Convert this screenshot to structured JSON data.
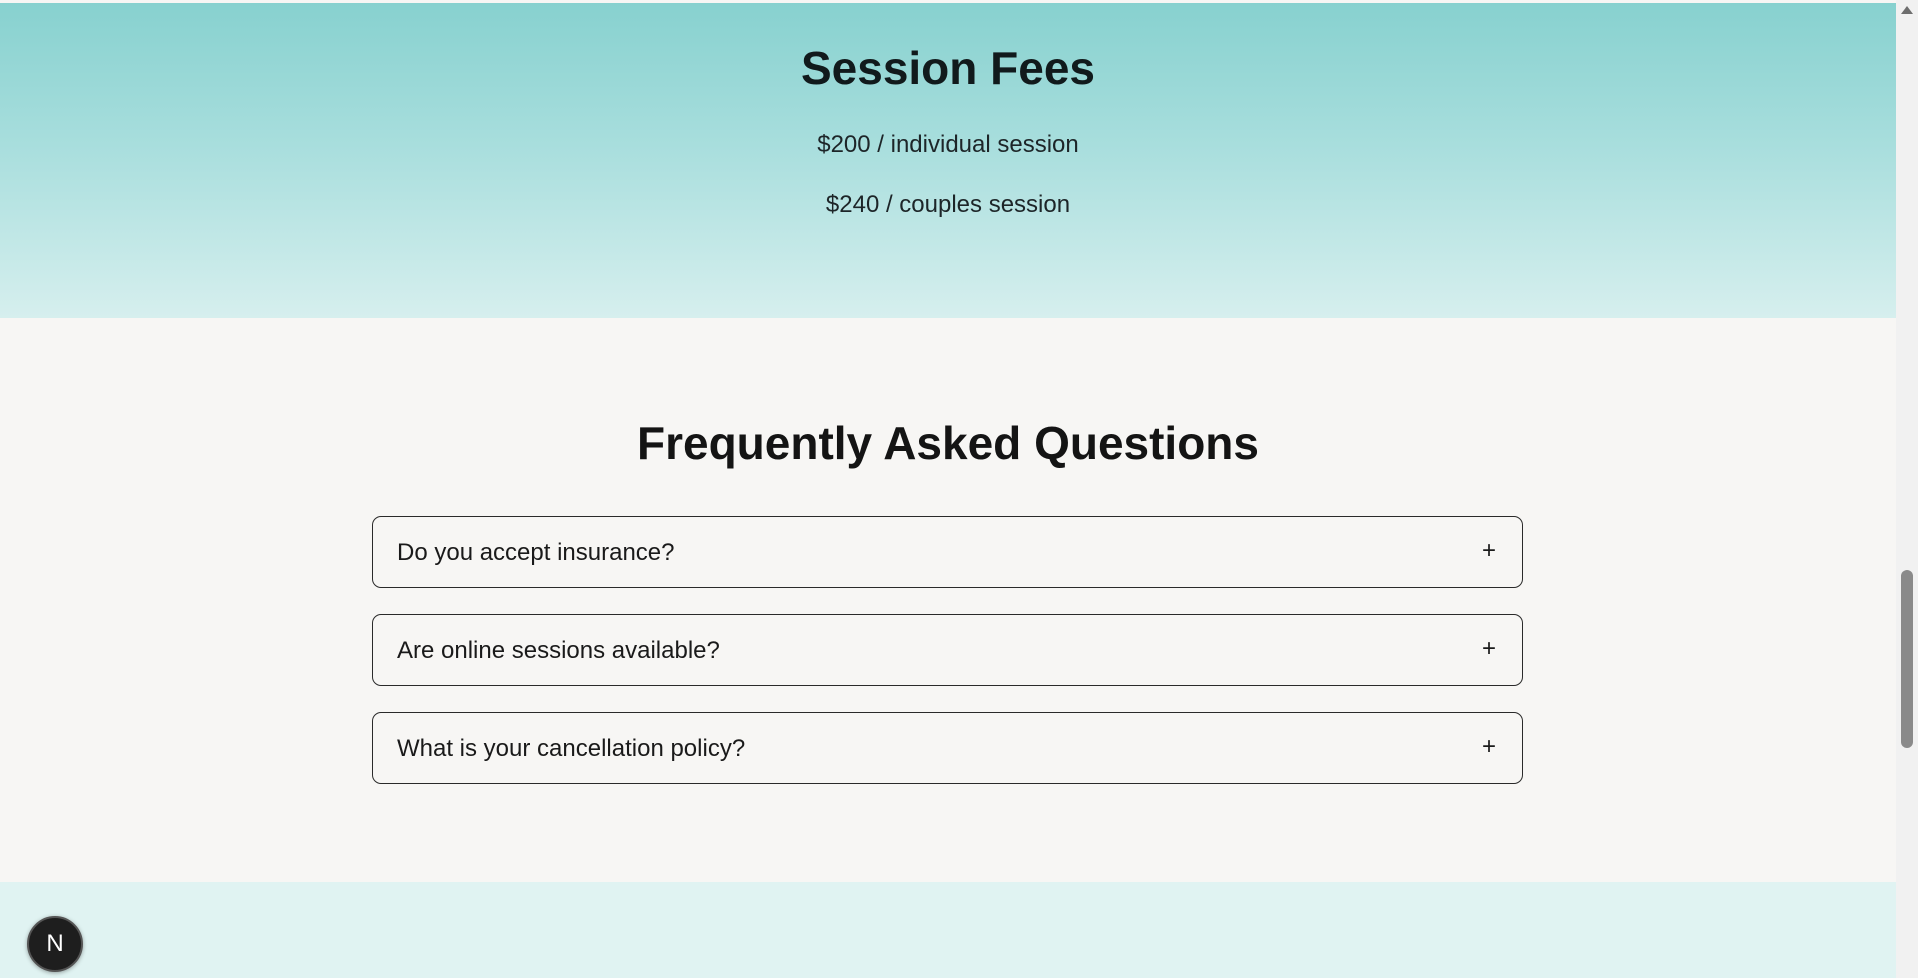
{
  "fees": {
    "title": "Session Fees",
    "individual": "$200 / individual session",
    "couples": "$240 / couples session"
  },
  "faq": {
    "title": "Frequently Asked Questions",
    "items": [
      {
        "question": "Do you accept insurance?",
        "toggle": "+"
      },
      {
        "question": "Are online sessions available?",
        "toggle": "+"
      },
      {
        "question": "What is your cancellation policy?",
        "toggle": "+"
      }
    ]
  },
  "badge": {
    "label": "N",
    "icon": "nextjs-logo-icon"
  },
  "colors": {
    "fees_gradient_top": "#87d1cf",
    "fees_gradient_bottom": "#d6efee",
    "faq_background": "#f7f6f4",
    "next_section_background": "#e0f3f2"
  }
}
